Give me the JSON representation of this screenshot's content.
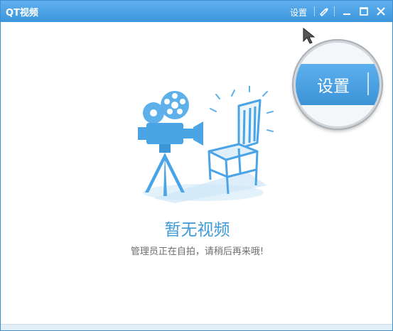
{
  "window": {
    "title": "QT视频"
  },
  "titlebar": {
    "settings_label": "设置",
    "buttons": [
      "skin-icon",
      "minimize-icon",
      "maximize-icon",
      "close-icon"
    ]
  },
  "magnifier": {
    "label": "设置"
  },
  "empty_state": {
    "title": "暂无视频",
    "subtitle": "管理员正在自拍，请稍后再来哦!"
  },
  "colors": {
    "accent": "#3d9ad9",
    "titlebar": "#4aa3e6",
    "text_muted": "#6e6e6e"
  }
}
